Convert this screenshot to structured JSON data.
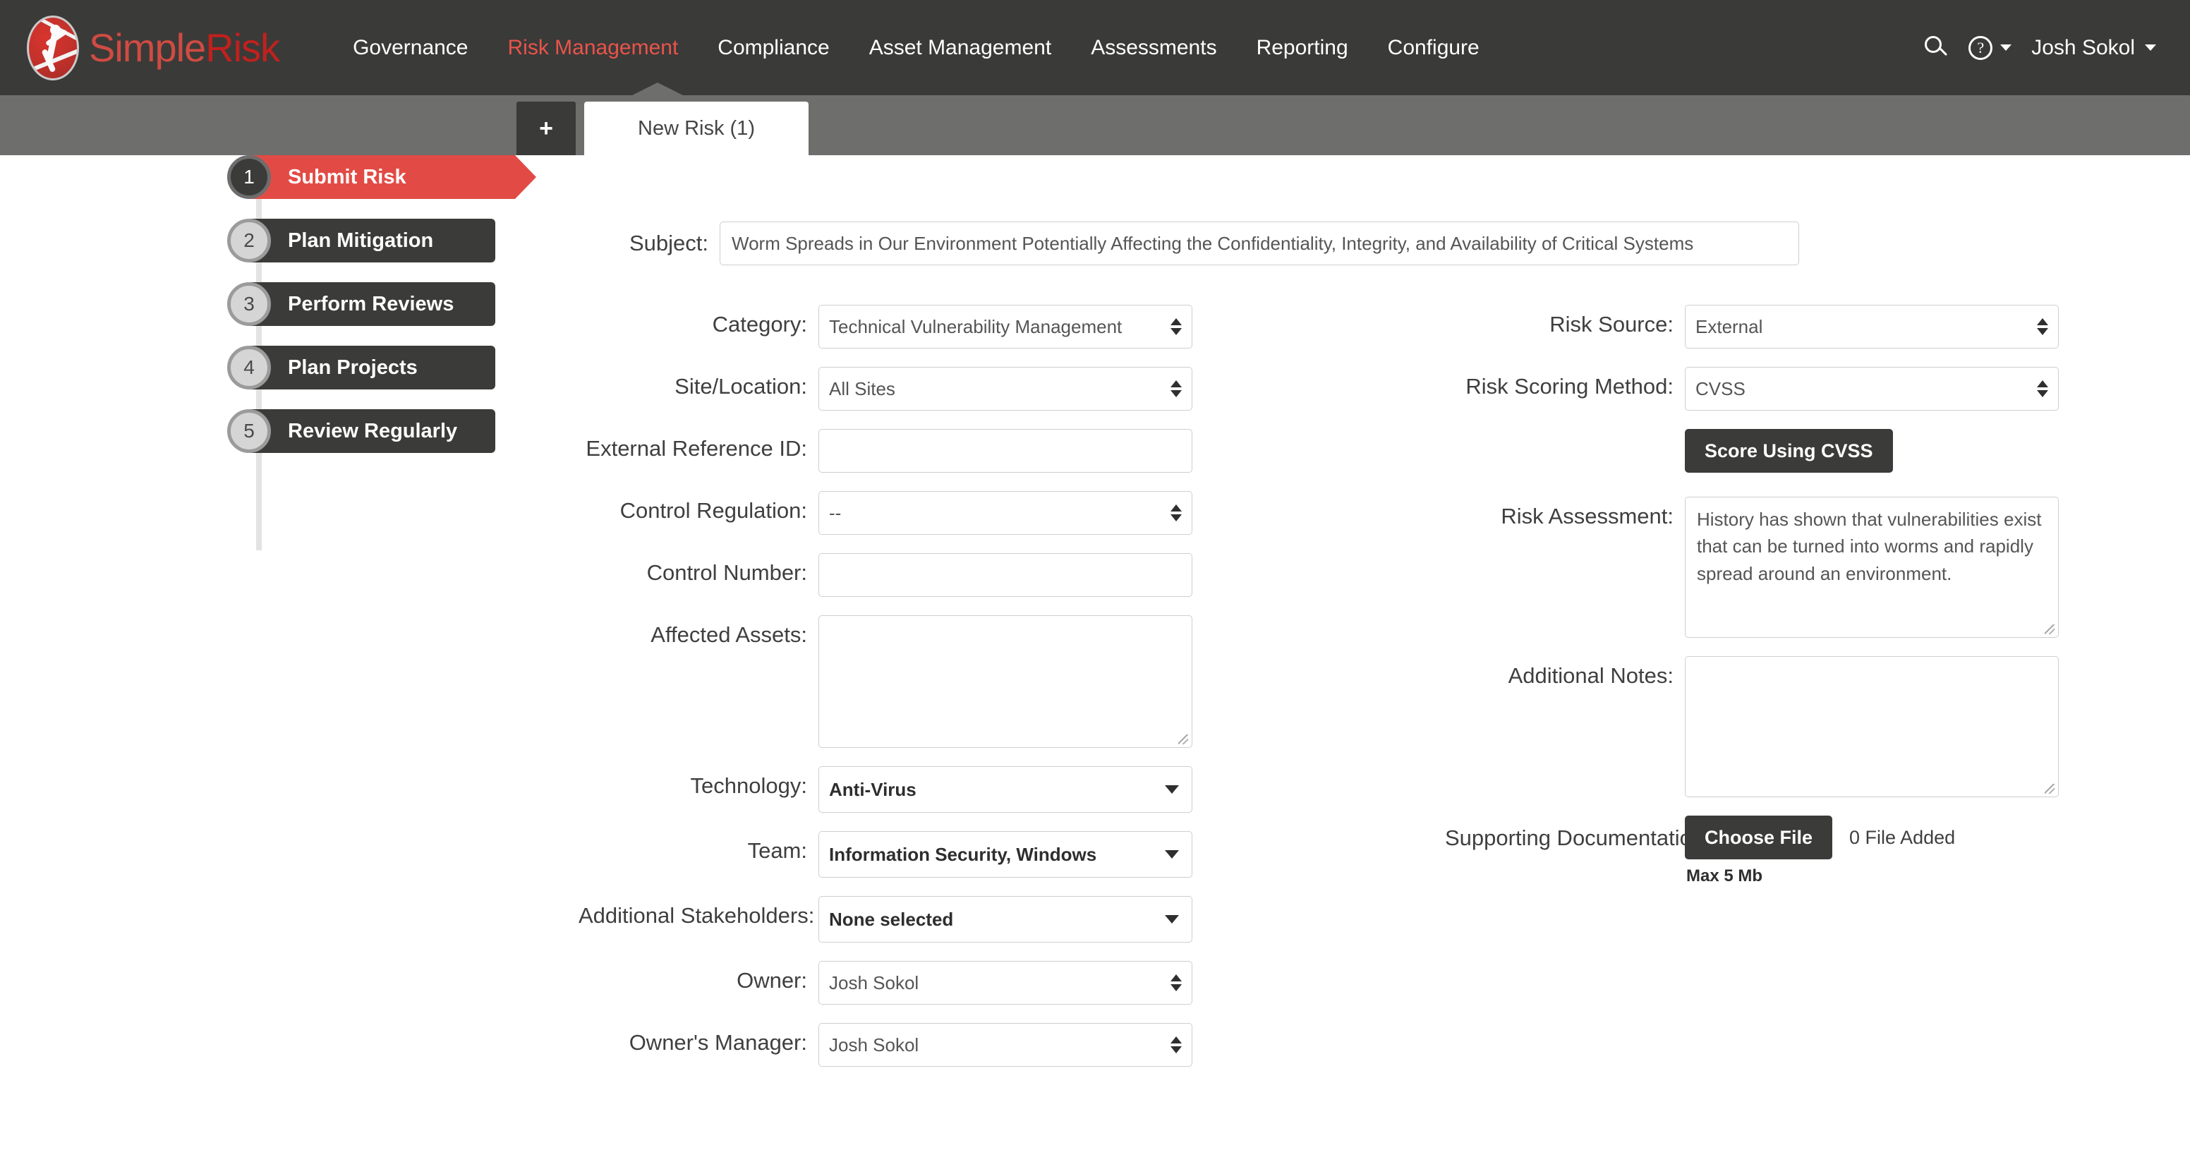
{
  "header": {
    "brand": {
      "part1": "Simple",
      "part2": "Risk",
      "logo_icon": "simplerisk-logo-icon"
    },
    "nav": [
      {
        "label": "Governance",
        "active": false
      },
      {
        "label": "Risk Management",
        "active": true
      },
      {
        "label": "Compliance",
        "active": false
      },
      {
        "label": "Asset Management",
        "active": false
      },
      {
        "label": "Assessments",
        "active": false
      },
      {
        "label": "Reporting",
        "active": false
      },
      {
        "label": "Configure",
        "active": false
      }
    ],
    "search_icon": "search-icon",
    "help_icon": "help-circle-icon",
    "help_caret": "chevron-down-icon",
    "user": "Josh Sokol",
    "user_caret": "chevron-down-icon",
    "accent_color": "#e8544b",
    "bar_color": "#3a3a38"
  },
  "tabs": {
    "add_label": "+",
    "items": [
      {
        "label": "New Risk (1)",
        "active": true
      }
    ],
    "bar_color": "#6e6e6c"
  },
  "steps": [
    {
      "num": "1",
      "label": "Submit Risk",
      "active": true
    },
    {
      "num": "2",
      "label": "Plan Mitigation",
      "active": false
    },
    {
      "num": "3",
      "label": "Perform Reviews",
      "active": false
    },
    {
      "num": "4",
      "label": "Plan Projects",
      "active": false
    },
    {
      "num": "5",
      "label": "Review Regularly",
      "active": false
    }
  ],
  "form": {
    "subject": {
      "label": "Subject:",
      "value": "Worm Spreads in Our Environment Potentially Affecting the Confidentiality, Integrity, and Availability of Critical Systems"
    },
    "left": {
      "category": {
        "label": "Category:",
        "value": "Technical Vulnerability Management"
      },
      "site_location": {
        "label": "Site/Location:",
        "value": "All Sites"
      },
      "external_ref_id": {
        "label": "External Reference ID:",
        "value": ""
      },
      "control_reg": {
        "label": "Control Regulation:",
        "value": "--"
      },
      "control_number": {
        "label": "Control Number:",
        "value": ""
      },
      "affected_assets": {
        "label": "Affected Assets:",
        "value": ""
      },
      "technology": {
        "label": "Technology:",
        "value": "Anti-Virus"
      },
      "team": {
        "label": "Team:",
        "value": "Information Security, Windows"
      },
      "stakeholders": {
        "label": "Additional Stakeholders:",
        "value": "None selected"
      },
      "owner": {
        "label": "Owner:",
        "value": "Josh Sokol"
      },
      "owners_manager": {
        "label": "Owner's Manager:",
        "value": "Josh Sokol"
      }
    },
    "right": {
      "risk_source": {
        "label": "Risk Source:",
        "value": "External"
      },
      "scoring_method": {
        "label": "Risk Scoring Method:",
        "value": "CVSS"
      },
      "score_button": "Score Using CVSS",
      "risk_assessment": {
        "label": "Risk Assessment:",
        "value": "History has shown that vulnerabilities exist that can be turned into worms and rapidly spread around an environment."
      },
      "additional_notes": {
        "label": "Additional Notes:",
        "value": ""
      },
      "supporting_doc": {
        "label": "Supporting Documentation",
        "button": "Choose File",
        "status": "0 File Added",
        "max": "Max 5 Mb"
      }
    }
  }
}
